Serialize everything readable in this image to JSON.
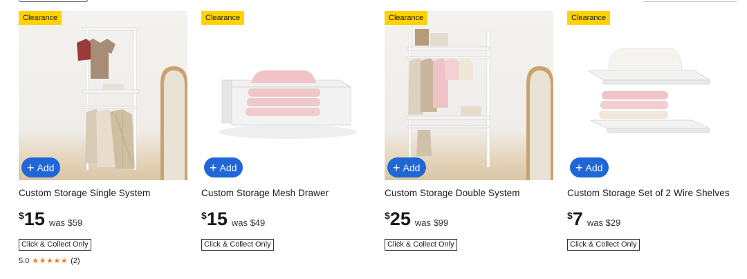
{
  "products": [
    {
      "badge": "Clearance",
      "add_label": "Add",
      "title": "Custom Storage Single System",
      "price_currency": "$",
      "price_value": "15",
      "was_price": "was $59",
      "collect_label": "Click & Collect Only",
      "rating_value": "5.0",
      "rating_stars": "★★★★★",
      "rating_count": "(2)"
    },
    {
      "badge": "Clearance",
      "add_label": "Add",
      "title": "Custom Storage Mesh Drawer",
      "price_currency": "$",
      "price_value": "15",
      "was_price": "was $49",
      "collect_label": "Click & Collect Only"
    },
    {
      "badge": "Clearance",
      "add_label": "Add",
      "title": "Custom Storage Double System",
      "price_currency": "$",
      "price_value": "25",
      "was_price": "was $99",
      "collect_label": "Click & Collect Only"
    },
    {
      "badge": "Clearance",
      "add_label": "Add",
      "title": "Custom Storage Set of 2 Wire Shelves",
      "price_currency": "$",
      "price_value": "7",
      "was_price": "was $29",
      "collect_label": "Click & Collect Only"
    }
  ],
  "colors": {
    "badge_bg": "#ffd200",
    "add_button_bg": "#1f66d6",
    "star_color": "#f07b1d"
  }
}
